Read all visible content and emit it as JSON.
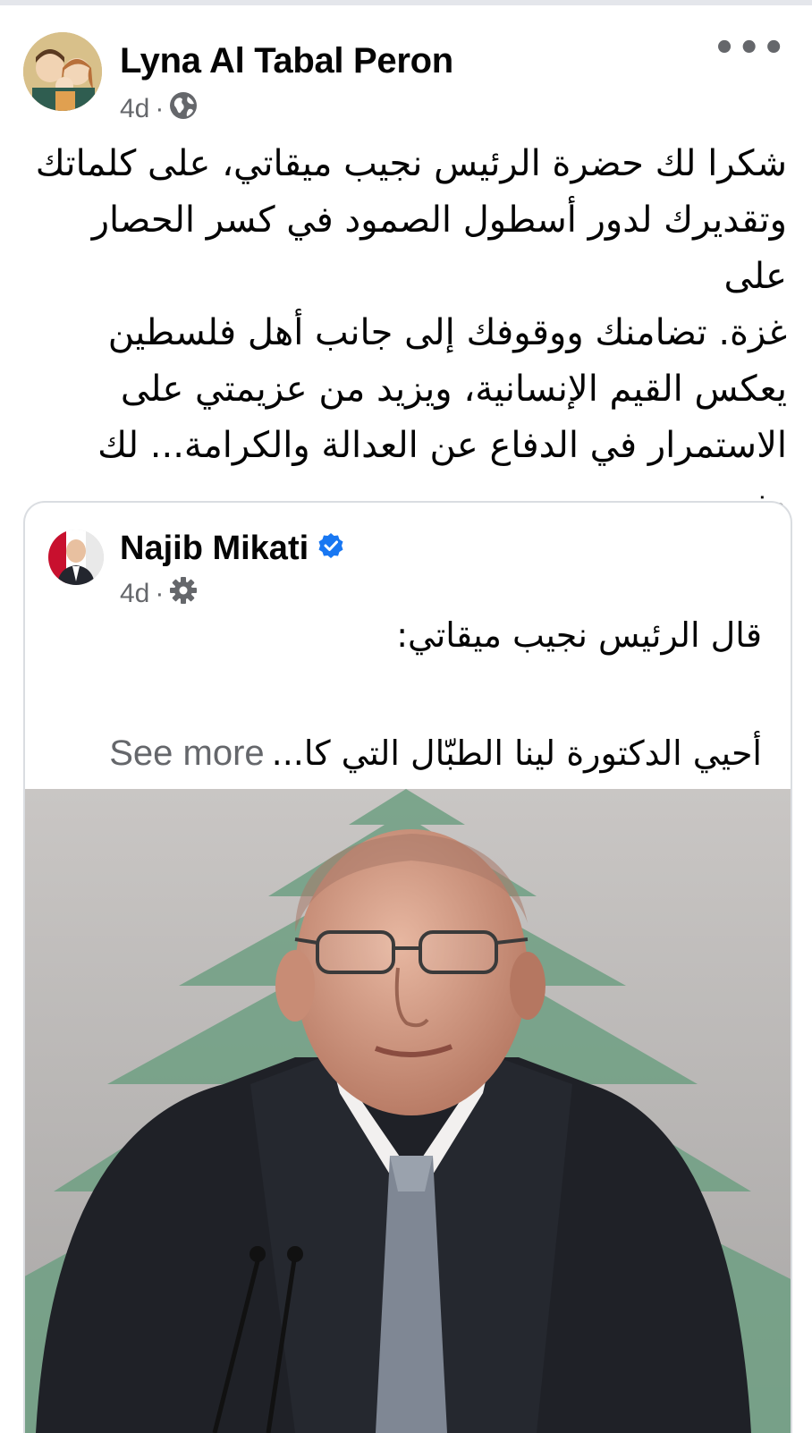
{
  "post": {
    "author": "Lyna Al Tabal Peron",
    "time": "4d",
    "separator": "·",
    "privacy_icon": "globe-icon",
    "more_icon": "ellipsis-icon",
    "more_label": "•••",
    "text": "شكرا لك حضرة الرئيس نجيب ميقاتي، على كلماتك\nوتقديرك لدور  أسطول الصمود في كسر الحصار على\nغزة. تضامنك ووقوفك إلى جانب أهل فلسطين\nيعكس القيم الإنسانية، ويزيد من عزيمتي على\nالاستمرار في الدفاع عن العدالة والكرامة... لك مني\nكل الاحترام والتقدير."
  },
  "shared": {
    "author": "Najib Mikati",
    "verified_icon": "verified-badge-icon",
    "time": "4d",
    "separator": "·",
    "audience_icon": "gear-icon",
    "line1": "قال الرئيس نجيب ميقاتي:",
    "line2": "أحيي  الدكتورة لينا الطبّال التي كا...",
    "see_more": "See more"
  },
  "colors": {
    "text_primary": "#050505",
    "text_secondary": "#65676b",
    "verified_blue": "#1877f2",
    "card_border": "#dadde1"
  }
}
